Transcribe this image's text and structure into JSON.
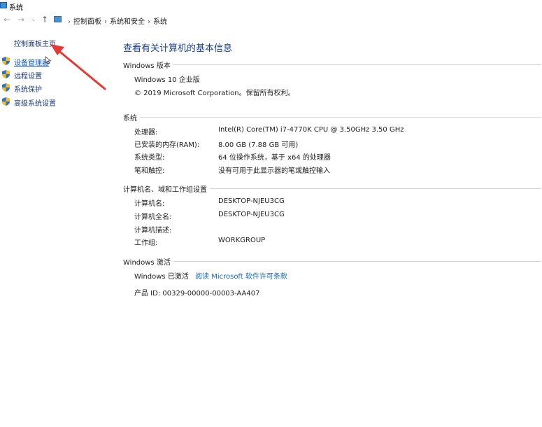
{
  "window": {
    "title": "系统"
  },
  "nav": {
    "back": "←",
    "forward": "→",
    "recent": "⌄",
    "up": "↑",
    "breadcrumb": [
      "控制面板",
      "系统和安全",
      "系统"
    ],
    "separator": "›"
  },
  "sidebar": {
    "home": "控制面板主页",
    "items": [
      {
        "label": "设备管理器",
        "icon": "shield-icon"
      },
      {
        "label": "远程设置",
        "icon": "shield-icon"
      },
      {
        "label": "系统保护",
        "icon": "shield-icon"
      },
      {
        "label": "高级系统设置",
        "icon": "shield-icon"
      }
    ]
  },
  "main": {
    "title": "查看有关计算机的基本信息",
    "edition": {
      "header": "Windows 版本",
      "name": "Windows 10 企业版",
      "copyright": "© 2019 Microsoft Corporation。保留所有权利。"
    },
    "system": {
      "header": "系统",
      "rows": [
        {
          "key": "处理器:",
          "value": "Intel(R) Core(TM) i7-4770K CPU @ 3.50GHz   3.50 GHz"
        },
        {
          "key": "已安装的内存(RAM):",
          "value": "8.00 GB (7.88 GB 可用)"
        },
        {
          "key": "系统类型:",
          "value": "64 位操作系统，基于 x64 的处理器"
        },
        {
          "key": "笔和触控:",
          "value": "没有可用于此显示器的笔或触控输入"
        }
      ]
    },
    "computer": {
      "header": "计算机名、域和工作组设置",
      "rows": [
        {
          "key": "计算机名:",
          "value": "DESKTOP-NJEU3CG"
        },
        {
          "key": "计算机全名:",
          "value": "DESKTOP-NJEU3CG"
        },
        {
          "key": "计算机描述:",
          "value": ""
        },
        {
          "key": "工作组:",
          "value": "WORKGROUP"
        }
      ]
    },
    "activation": {
      "header": "Windows 激活",
      "status": "Windows 已激活",
      "license_link": "阅读 Microsoft 软件许可条款",
      "product_id": "产品 ID: 00329-00000-00003-AA407"
    }
  },
  "colors": {
    "link": "#1565c0",
    "title": "#1a3e8c",
    "annotation_arrow": "#e53935"
  }
}
